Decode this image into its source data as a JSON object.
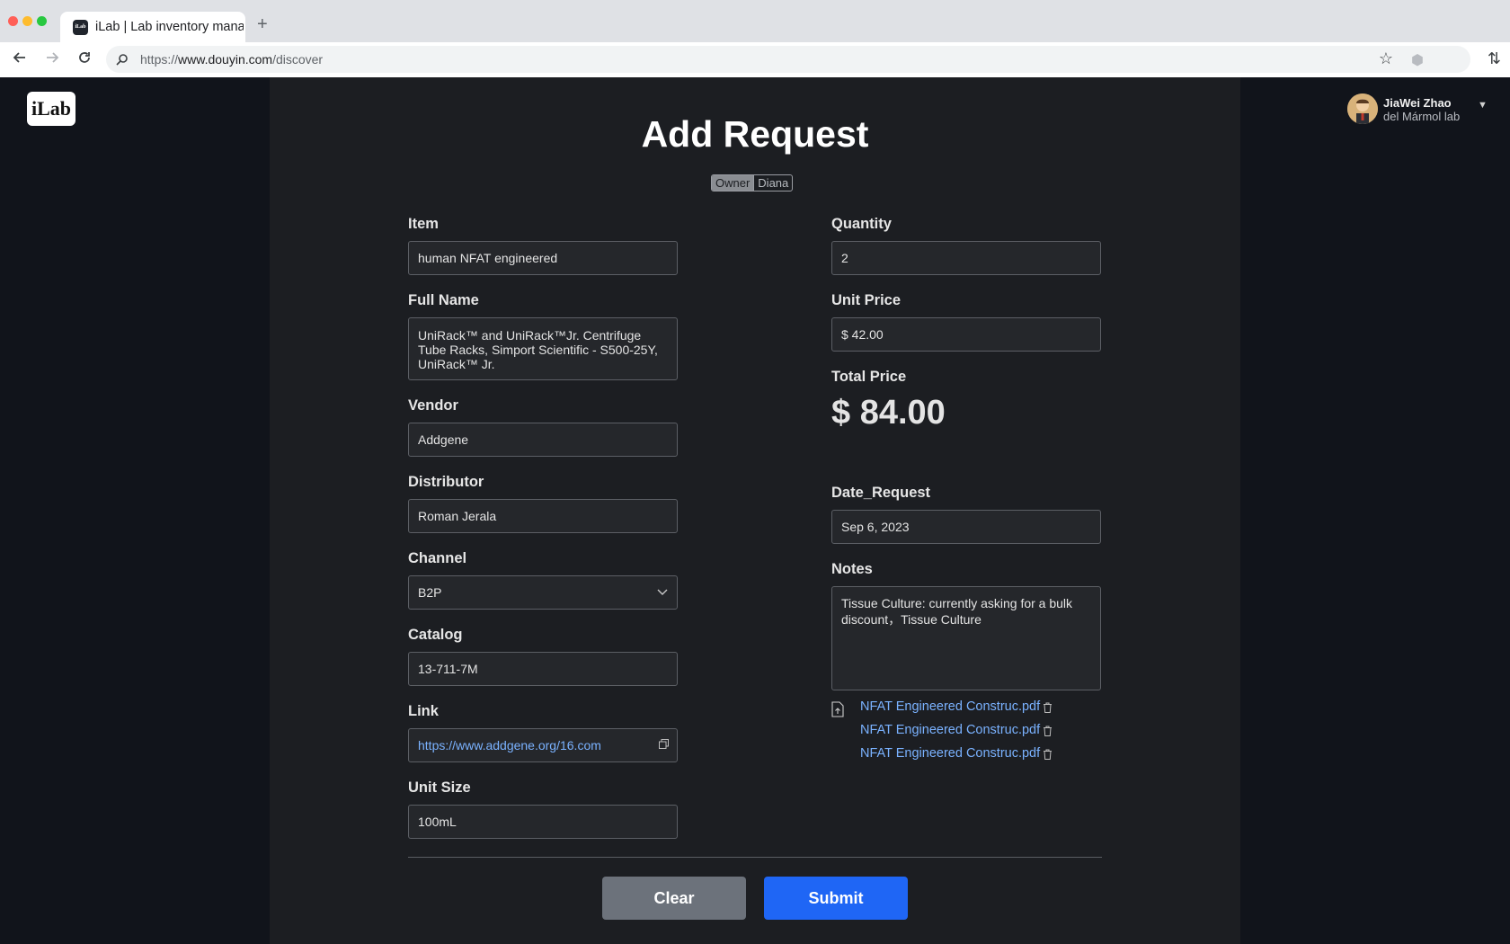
{
  "browser": {
    "tab_title": "iLab | Lab inventory mana",
    "tab_favicon_text": "iLab",
    "url_prefix": "https://",
    "url_host": "www.douyin.com",
    "url_path": "/discover"
  },
  "app": {
    "logo": "iLab",
    "user": {
      "name": "JiaWei Zhao",
      "lab": "del Mármol lab"
    },
    "page_title": "Add Request",
    "owner": {
      "key": "Owner",
      "value": "Diana"
    }
  },
  "form": {
    "item": {
      "label": "Item",
      "value": "human NFAT engineered"
    },
    "full_name": {
      "label": "Full Name",
      "value": "UniRack™ and UniRack™Jr. Centrifuge Tube Racks, Simport Scientific - S500-25Y, UniRack™ Jr."
    },
    "vendor": {
      "label": "Vendor",
      "value": "Addgene"
    },
    "distributor": {
      "label": "Distributor",
      "value": "Roman Jerala"
    },
    "channel": {
      "label": "Channel",
      "value": "B2P"
    },
    "catalog": {
      "label": "Catalog",
      "value": "13-711-7M"
    },
    "link": {
      "label": "Link",
      "value": "https://www.addgene.org/16.com"
    },
    "unit_size": {
      "label": "Unit Size",
      "value": "100mL"
    },
    "quantity": {
      "label": "Quantity",
      "value": "2"
    },
    "unit_price": {
      "label": "Unit Price",
      "value": "$ 42.00"
    },
    "total_price": {
      "label": "Total Price",
      "value": "$ 84.00"
    },
    "date_request": {
      "label": "Date_Request",
      "value": "Sep 6, 2023"
    },
    "notes": {
      "label": "Notes",
      "value": "Tissue Culture: currently asking for a bulk discount，Tissue Culture"
    }
  },
  "attachments": [
    "NFAT Engineered Construc.pdf",
    "NFAT Engineered Construc.pdf",
    "NFAT Engineered Construc.pdf"
  ],
  "actions": {
    "clear": "Clear",
    "submit": "Submit"
  },
  "icons": {
    "back": "arrow-left-icon",
    "forward": "arrow-right-icon",
    "reload": "reload-icon",
    "search": "search-icon",
    "star": "star-icon",
    "extension": "extension-icon",
    "chevron": "chevron-down-icon",
    "copy": "copy-icon",
    "upload": "file-upload-icon",
    "trash": "trash-icon"
  },
  "colors": {
    "accent": "#1f66f5",
    "link": "#7ab2ff",
    "clear_button": "#6c727b",
    "panel_bg": "#1c1e22",
    "page_bg": "#11141b"
  }
}
